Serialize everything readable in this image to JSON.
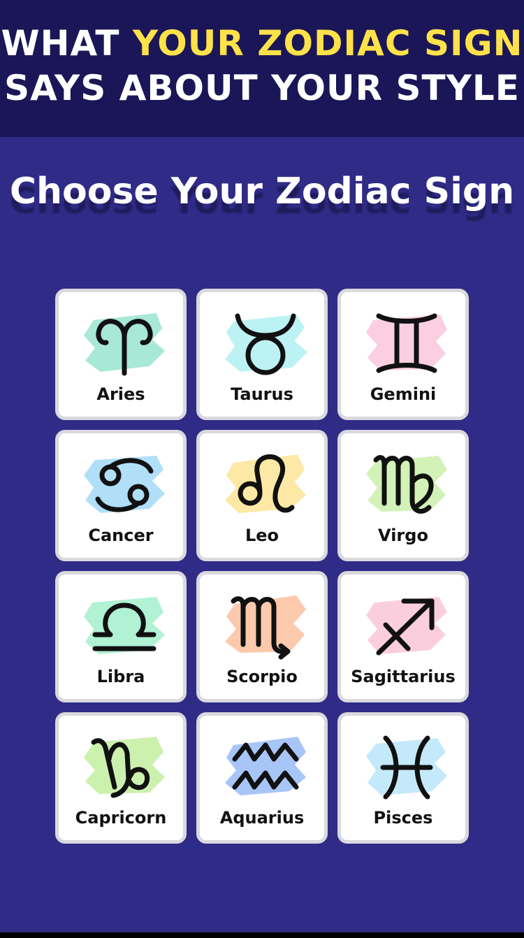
{
  "header": {
    "line1_prefix": "WHAT ",
    "line1_highlight": "YOUR ZODIAC SIGN",
    "line2": "SAYS ABOUT YOUR STYLE",
    "highlight_color": "#ffe24a",
    "background_color": "#1b1657"
  },
  "choose_title": "Choose Your Zodiac Sign",
  "page_background": "#2f2b86",
  "signs": [
    {
      "label": "Aries",
      "icon": "aries-icon",
      "brush_color": "#9ee6d3"
    },
    {
      "label": "Taurus",
      "icon": "taurus-icon",
      "brush_color": "#b6f1f3"
    },
    {
      "label": "Gemini",
      "icon": "gemini-icon",
      "brush_color": "#fbc9de"
    },
    {
      "label": "Cancer",
      "icon": "cancer-icon",
      "brush_color": "#a9dcf7"
    },
    {
      "label": "Leo",
      "icon": "leo-icon",
      "brush_color": "#fde79b"
    },
    {
      "label": "Virgo",
      "icon": "virgo-icon",
      "brush_color": "#cdf1b0"
    },
    {
      "label": "Libra",
      "icon": "libra-icon",
      "brush_color": "#a8f0cf"
    },
    {
      "label": "Scorpio",
      "icon": "scorpio-icon",
      "brush_color": "#fcc3a3"
    },
    {
      "label": "Sagittarius",
      "icon": "sagittarius-icon",
      "brush_color": "#fbc9d9"
    },
    {
      "label": "Capricorn",
      "icon": "capricorn-icon",
      "brush_color": "#c6f0a6"
    },
    {
      "label": "Aquarius",
      "icon": "aquarius-icon",
      "brush_color": "#9fbff7"
    },
    {
      "label": "Pisces",
      "icon": "pisces-icon",
      "brush_color": "#bde7fb"
    }
  ]
}
